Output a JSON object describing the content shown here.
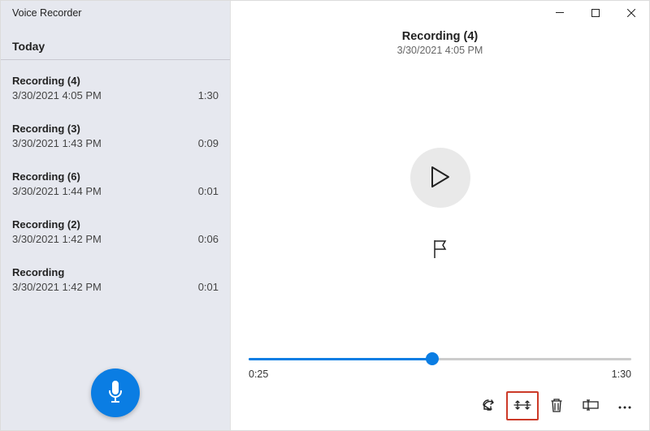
{
  "app": {
    "title": "Voice Recorder",
    "section_header": "Today"
  },
  "recordings": [
    {
      "title": "Recording (4)",
      "date": "3/30/2021 4:05 PM",
      "duration": "1:30"
    },
    {
      "title": "Recording (3)",
      "date": "3/30/2021 1:43 PM",
      "duration": "0:09"
    },
    {
      "title": "Recording (6)",
      "date": "3/30/2021 1:44 PM",
      "duration": "0:01"
    },
    {
      "title": "Recording (2)",
      "date": "3/30/2021 1:42 PM",
      "duration": "0:06"
    },
    {
      "title": "Recording",
      "date": "3/30/2021 1:42 PM",
      "duration": "0:01"
    }
  ],
  "selected": {
    "title": "Recording (4)",
    "date": "3/30/2021 4:05 PM",
    "duration": "1:30",
    "position": "0:25",
    "progress_percent": 48
  },
  "colors": {
    "accent": "#0a7de3",
    "sidebar_bg": "#e6e8ef",
    "highlight_border": "#cc3a28"
  },
  "icons": {
    "microphone": "microphone-icon",
    "play": "play-icon",
    "flag": "flag-icon",
    "share": "share-icon",
    "trim": "trim-icon",
    "delete": "trash-icon",
    "rename": "rename-icon",
    "more": "more-icon",
    "minimize": "minimize-icon",
    "maximize": "maximize-icon",
    "close": "close-icon"
  }
}
